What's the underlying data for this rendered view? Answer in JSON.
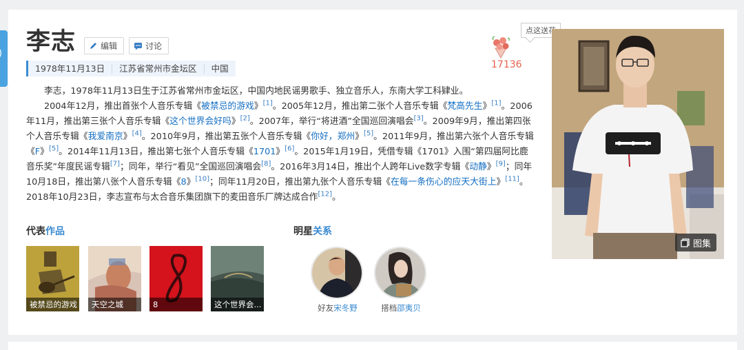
{
  "side_tab": {
    "label": ")"
  },
  "entry": {
    "title": "李志",
    "edit_label": "编辑",
    "discuss_label": "讨论",
    "info": [
      "1978年11月13日",
      "江苏省常州市金坛区",
      "中国"
    ]
  },
  "flower": {
    "tip": "点这送花",
    "count": "17136"
  },
  "intro": {
    "p1": "李志，1978年11月13日生于江苏省常州市金坛区，中国内地民谣男歌手、独立音乐人，东南大学工科肄业。",
    "p2": [
      "2004年12月，推出首张个人音乐专辑《",
      "被禁忌的游戏",
      "》",
      "[1]",
      "。2005年12月，推出第二张个人音乐专辑《",
      "梵高先生",
      "》",
      "[1]",
      "。2006年11月，推出第三张个人音乐专辑《",
      "这个世界会好吗",
      "》",
      "[2]",
      "。2007年，举行“将进酒”全国巡回演唱会",
      "[3]",
      "。2009年9月，推出第四张个人音乐专辑《",
      "我爱南京",
      "》",
      "[4]",
      "。2010年9月，推出第五张个人音乐专辑《",
      "你好，郑州",
      "》",
      "[5]",
      "。2011年9月，推出第六张个人音乐专辑《",
      "F",
      "》",
      "[5]",
      "。2014年11月13日，推出第七张个人音乐专辑《",
      "1701",
      "》",
      "[6]",
      "。2015年1月19日，凭借专辑《1701》入围“第四届阿比鹿音乐奖”年度民谣专辑",
      "[7]",
      "；同年，举行“看见”全国巡回演唱会",
      "[8]",
      "。2016年3月14日，推出个人跨年Live数字专辑《",
      "动静",
      "》",
      "[9]",
      "；同年10月18日，推出第八张个人音乐专辑《",
      "8",
      "》",
      "[10]",
      "；同年11月20日，推出第九张个人音乐专辑《",
      "在每一条伤心的应天大街上",
      "》",
      "[11]",
      "。2018年10月23日，李志宣布与太合音乐集团旗下的麦田音乐厂牌达成合作",
      "[12]",
      "。"
    ]
  },
  "photo": {
    "atlas_label": "图集"
  },
  "works": {
    "title_plain": "代表",
    "title_blue": "作品",
    "items": [
      "被禁忌的游戏",
      "天空之城",
      "8",
      "这个世界会..."
    ]
  },
  "relations": {
    "title_plain": "明星",
    "title_blue": "关系",
    "items": [
      {
        "role": "好友",
        "name": "宋冬野"
      },
      {
        "role": "搭档",
        "name": "邵夷贝"
      }
    ]
  }
}
